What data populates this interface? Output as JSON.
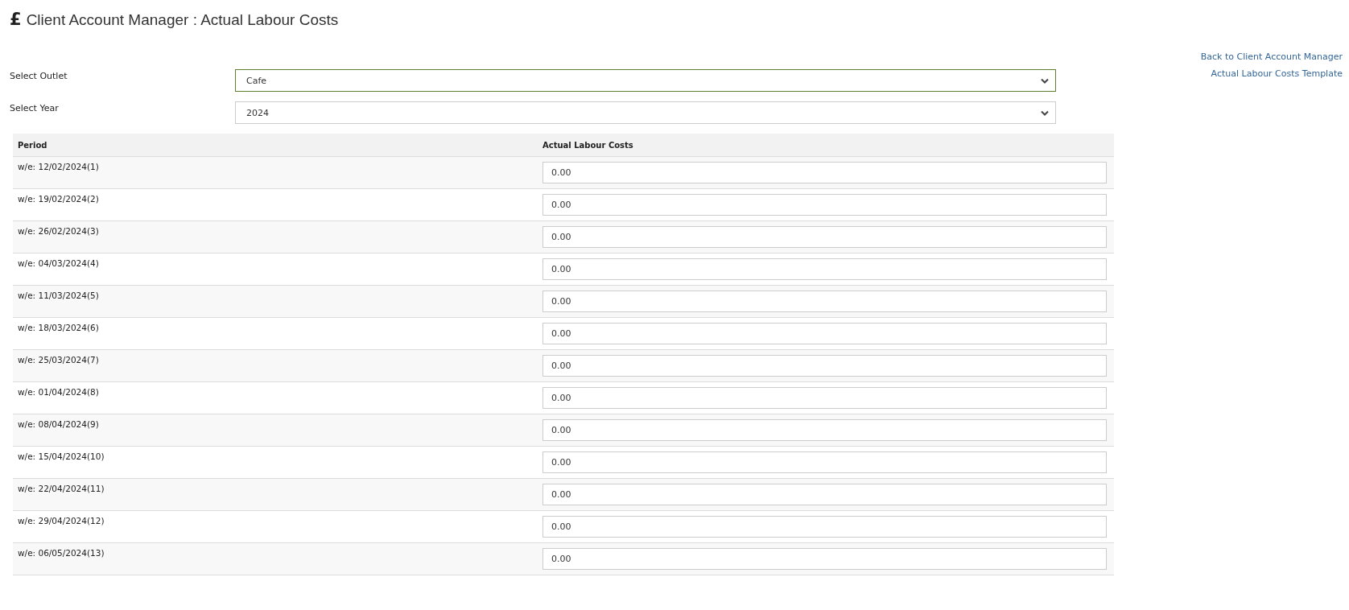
{
  "page": {
    "icon": "£",
    "title": "Client Account Manager : Actual Labour Costs"
  },
  "links": [
    "Back to Client Account Manager",
    "Actual Labour Costs Template"
  ],
  "filters": [
    {
      "label": "Select Outlet",
      "value": "Cafe",
      "focused": true
    },
    {
      "label": "Select Year",
      "value": "2024",
      "focused": false
    }
  ],
  "table": {
    "columns": [
      "Period",
      "Actual Labour Costs"
    ],
    "rows": [
      {
        "period": "w/e: 12/02/2024(1)",
        "cost": "0.00"
      },
      {
        "period": "w/e: 19/02/2024(2)",
        "cost": "0.00"
      },
      {
        "period": "w/e: 26/02/2024(3)",
        "cost": "0.00"
      },
      {
        "period": "w/e: 04/03/2024(4)",
        "cost": "0.00"
      },
      {
        "period": "w/e: 11/03/2024(5)",
        "cost": "0.00"
      },
      {
        "period": "w/e: 18/03/2024(6)",
        "cost": "0.00"
      },
      {
        "period": "w/e: 25/03/2024(7)",
        "cost": "0.00"
      },
      {
        "period": "w/e: 01/04/2024(8)",
        "cost": "0.00"
      },
      {
        "period": "w/e: 08/04/2024(9)",
        "cost": "0.00"
      },
      {
        "period": "w/e: 15/04/2024(10)",
        "cost": "0.00"
      },
      {
        "period": "w/e: 22/04/2024(11)",
        "cost": "0.00"
      },
      {
        "period": "w/e: 29/04/2024(12)",
        "cost": "0.00"
      },
      {
        "period": "w/e: 06/05/2024(13)",
        "cost": "0.00"
      }
    ]
  }
}
